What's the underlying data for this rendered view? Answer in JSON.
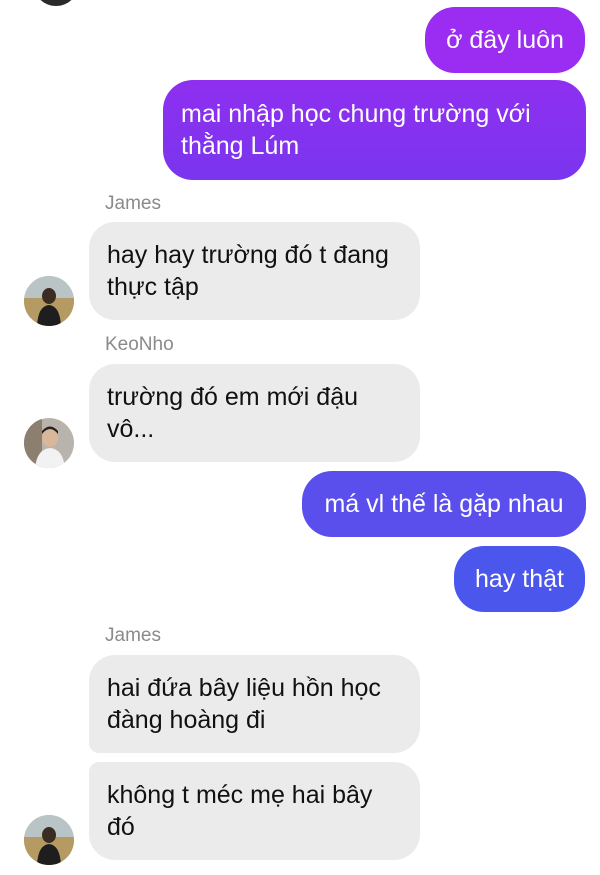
{
  "conversation": {
    "msg1": {
      "text": "ở đây luôn"
    },
    "msg2": {
      "text": "mai nhập học chung trường với\nthằng Lúm"
    },
    "sender1": {
      "name": "James"
    },
    "msg3": {
      "text": "hay hay trường đó t đang\nthực tập"
    },
    "sender2": {
      "name": "KeoNho"
    },
    "msg4": {
      "text": "trường đó em mới đậu\nvô..."
    },
    "msg5": {
      "text": "má vl thế là gặp nhau"
    },
    "msg6": {
      "text": "hay thật"
    },
    "sender3": {
      "name": "James"
    },
    "msg7": {
      "text": "hai đứa bây liệu hồn học\nđàng hoàng đi"
    },
    "msg8": {
      "text": "không t méc mẹ hai bây\nđó"
    }
  },
  "avatars": {
    "james": "james-avatar-icon",
    "keonho": "keonho-avatar-icon"
  },
  "colors": {
    "sent_top": "#9a2bf0",
    "sent_mid": "#7b35ee",
    "sent_bottom": "#4a56ec",
    "received_bg": "#ebebec",
    "sender_name": "#8a8a8a"
  }
}
